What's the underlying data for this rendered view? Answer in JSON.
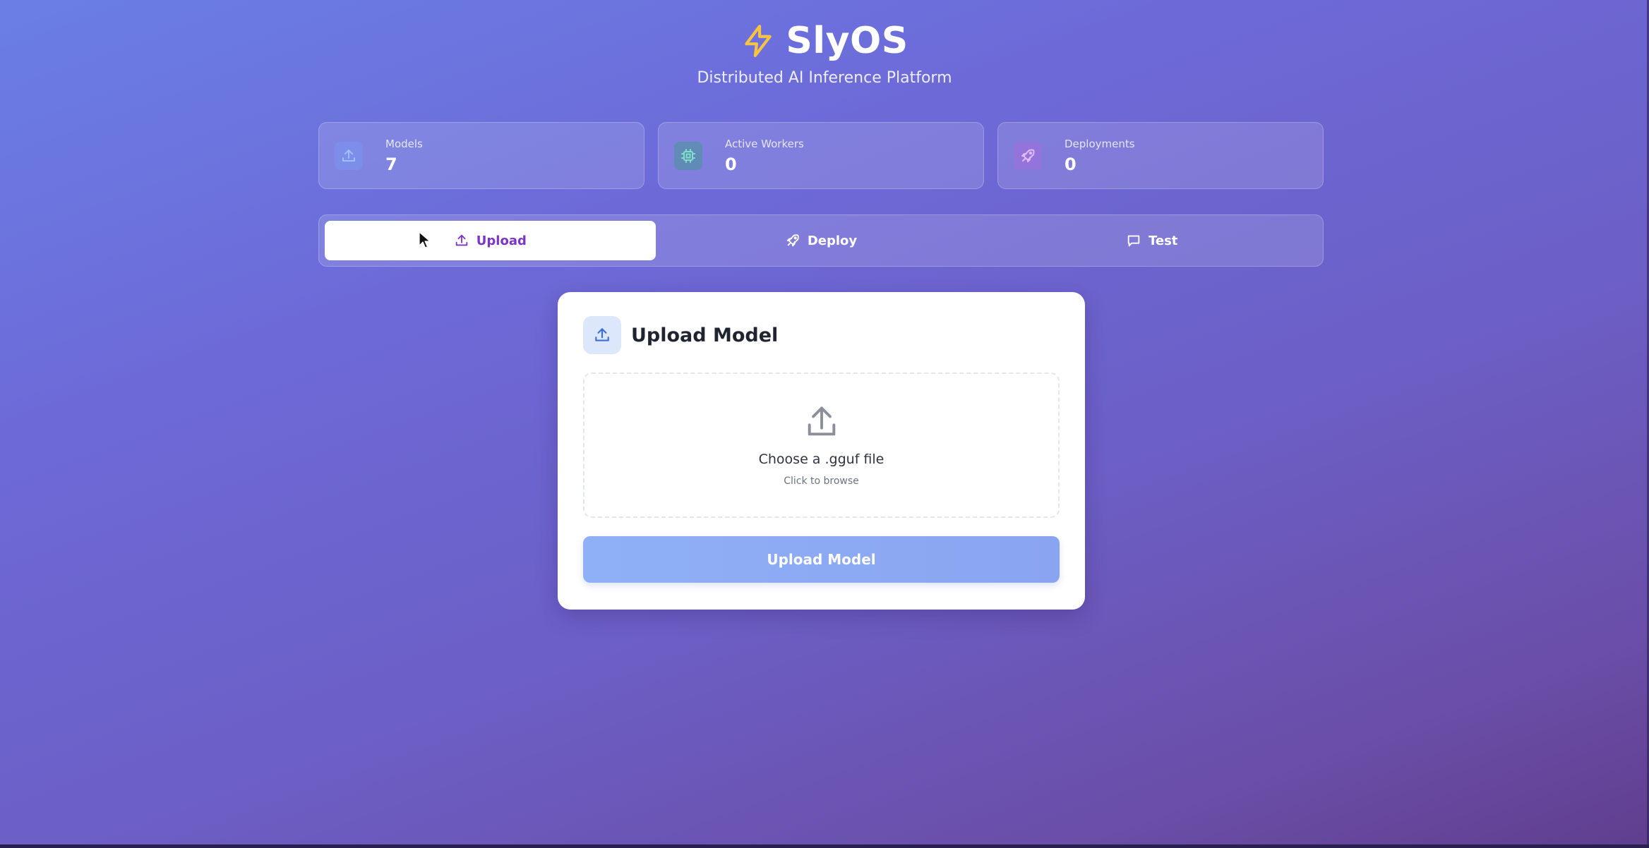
{
  "header": {
    "brand": "SlyOS",
    "tagline": "Distributed AI Inference Platform"
  },
  "stats": [
    {
      "label": "Models",
      "value": "7",
      "icon": "upload-icon"
    },
    {
      "label": "Active Workers",
      "value": "0",
      "icon": "cpu-icon"
    },
    {
      "label": "Deployments",
      "value": "0",
      "icon": "rocket-icon"
    }
  ],
  "tabs": [
    {
      "label": "Upload",
      "icon": "upload-icon",
      "active": true
    },
    {
      "label": "Deploy",
      "icon": "rocket-icon",
      "active": false
    },
    {
      "label": "Test",
      "icon": "chat-icon",
      "active": false
    }
  ],
  "upload_card": {
    "title": "Upload Model",
    "dropzone_title": "Choose a .gguf file",
    "dropzone_subtitle": "Click to browse",
    "button_label": "Upload Model"
  },
  "colors": {
    "accent_active_tab": "#7b35c8",
    "bolt": "#f6c343",
    "button": "#8fb0f6"
  }
}
